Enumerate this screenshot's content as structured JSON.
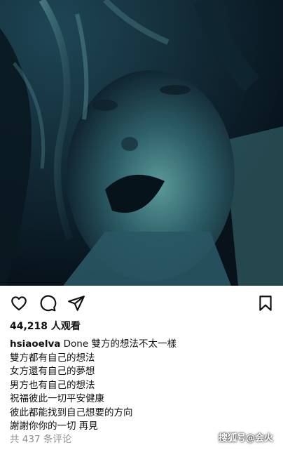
{
  "post": {
    "likes_text": "44,218 人观看",
    "username": "hsiaoelva",
    "caption_first": " Done 雙方的想法不太一樣",
    "caption_lines": [
      "雙方都有自己的想法",
      "女方還有自己的夢想",
      "男方也有自己的想法",
      "祝福彼此一切平安健康",
      "彼此都能找到自己想要的方向",
      "謝謝你你的一切  再見"
    ],
    "comments_text": "共 437 条评论"
  },
  "actions": {
    "like_icon": "heart-icon",
    "comment_icon": "comment-icon",
    "share_icon": "paper-plane-icon",
    "save_icon": "bookmark-icon"
  },
  "watermark": {
    "text": "搜狐号@会火"
  },
  "colors": {
    "photo_tint": "#2f6a72",
    "text": "#111111",
    "muted": "#8e8e8e"
  }
}
